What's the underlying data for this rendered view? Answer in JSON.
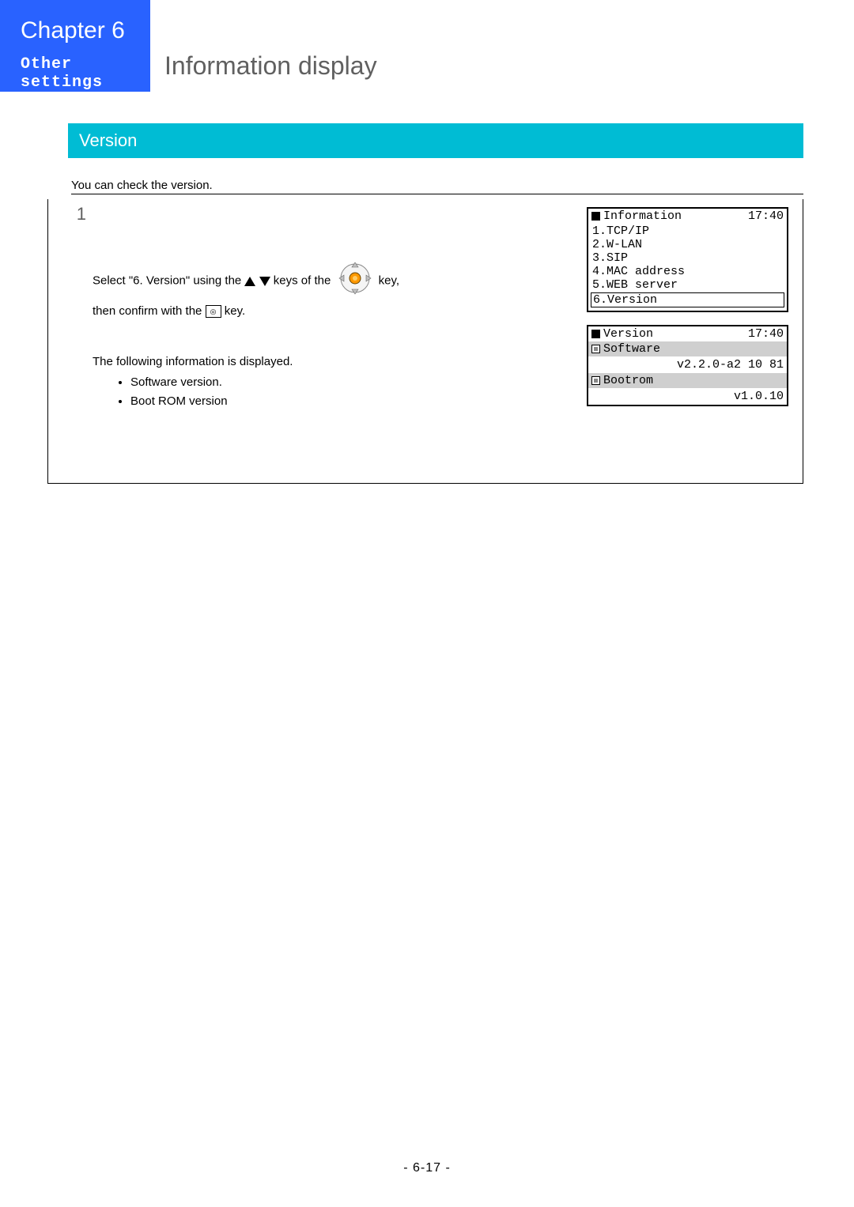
{
  "header": {
    "chapter": "Chapter 6",
    "subtitle": "Other settings",
    "title": "Information display"
  },
  "section": {
    "label": "Version"
  },
  "intro": "You can check the version.",
  "step": {
    "no": "1",
    "line1a": "Select \"6. Version\" using the ",
    "line1b": " keys of the ",
    "line1c": " key,",
    "line2a": "then confirm with the ",
    "line2b": " key.",
    "disp_intro": "The following information is displayed.",
    "bullets": [
      "Software version.",
      "Boot ROM version"
    ]
  },
  "screen1": {
    "title": "Information",
    "time": "17:40",
    "items": [
      "1.TCP/IP",
      "2.W-LAN",
      "3.SIP",
      "4.MAC address",
      "5.WEB server",
      "6.Version"
    ]
  },
  "screen2": {
    "title": "Version",
    "time": "17:40",
    "row1": "Software",
    "val1": "v2.2.0-a2 10 81",
    "row2": "Bootrom",
    "val2": "v1.0.10"
  },
  "page_number": "- 6-17 -",
  "okkey_glyph": "◎"
}
